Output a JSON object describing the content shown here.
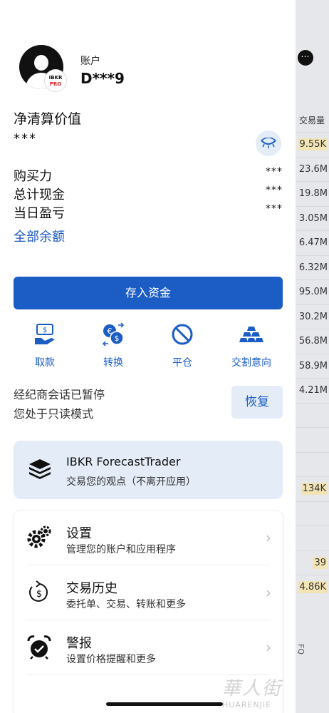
{
  "background_table": {
    "header": "交易量",
    "more_icon": "⋯",
    "rows": [
      {
        "value": "9.55K",
        "highlight": true
      },
      {
        "value": "23.6M",
        "highlight": false
      },
      {
        "value": "19.8M",
        "highlight": false
      },
      {
        "value": "3.05M",
        "highlight": false
      },
      {
        "value": "6.47M",
        "highlight": false
      },
      {
        "value": "6.32M",
        "highlight": false
      },
      {
        "value": "95.0M",
        "highlight": false
      },
      {
        "value": "30.2M",
        "highlight": false
      },
      {
        "value": "56.8M",
        "highlight": false
      },
      {
        "value": "58.9M",
        "highlight": false
      },
      {
        "value": "4.21M",
        "highlight": false
      },
      {
        "value": "",
        "highlight": false
      },
      {
        "value": "",
        "highlight": false
      },
      {
        "value": "",
        "highlight": false
      },
      {
        "value": "134K",
        "highlight": true
      },
      {
        "value": "",
        "highlight": false
      },
      {
        "value": "",
        "highlight": false
      },
      {
        "value": "39",
        "highlight": true
      },
      {
        "value": "4.86K",
        "highlight": true
      }
    ],
    "side_label": "FQ"
  },
  "account": {
    "label": "账户",
    "id": "D***9",
    "badge_top": "IBKR",
    "badge_bottom": "PRO"
  },
  "net_liquidation": {
    "label": "净清算价值",
    "value": "***",
    "toggle_icon": "eye-closed-icon"
  },
  "balances": [
    {
      "label": "购买力",
      "value": "***"
    },
    {
      "label": "总计现金",
      "value": "***"
    },
    {
      "label": "当日盈亏",
      "value": "***"
    }
  ],
  "all_balances_link": "全部余额",
  "deposit_button": "存入资金",
  "quick_actions": [
    {
      "label": "取款",
      "icon": "withdraw-icon"
    },
    {
      "label": "转换",
      "icon": "currency-exchange-icon"
    },
    {
      "label": "平仓",
      "icon": "close-position-icon"
    },
    {
      "label": "交割意向",
      "icon": "gold-bars-icon"
    }
  ],
  "session": {
    "line1": "经纪商会话已暂停",
    "line2": "您处于只读模式",
    "resume_button": "恢复"
  },
  "forecast_trader": {
    "title": "IBKR ForecastTrader",
    "subtitle": "交易您的观点（不离开应用）"
  },
  "menu": [
    {
      "title": "设置",
      "subtitle": "管理您的账户和应用程序",
      "icon": "gears-icon"
    },
    {
      "title": "交易历史",
      "subtitle": "委托单、交易、转账和更多",
      "icon": "history-dollar-icon"
    },
    {
      "title": "警报",
      "subtitle": "设置价格提醒和更多",
      "icon": "alarm-clock-icon"
    }
  ],
  "watermark": {
    "big": "華人街",
    "small": "HUARENJIE"
  },
  "colors": {
    "accent": "#1b5dc4",
    "accent_light": "#e4ecf7",
    "highlight": "#f3e4b5"
  }
}
